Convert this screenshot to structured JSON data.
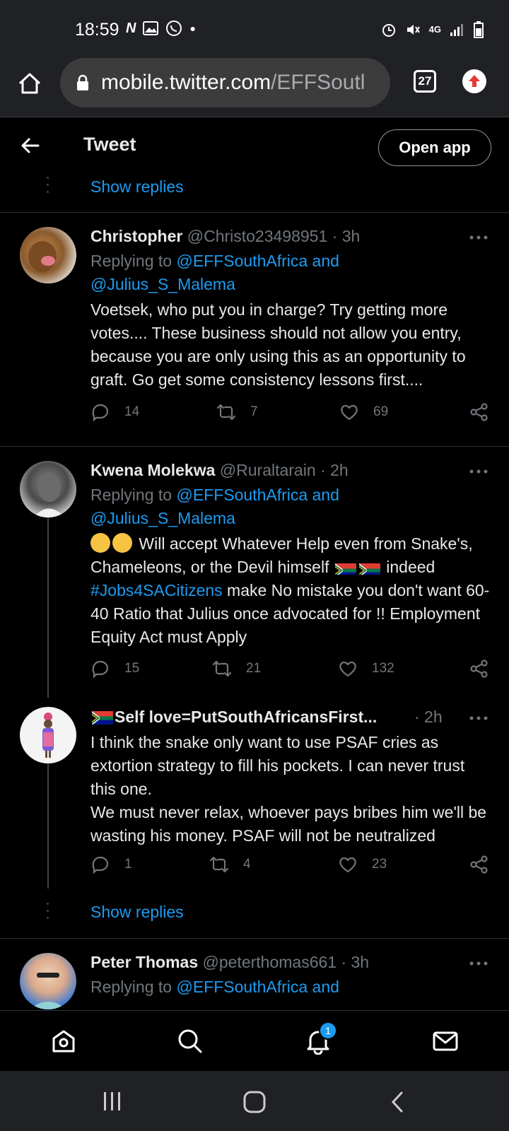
{
  "status_bar": {
    "time": "18:59",
    "network": "4G"
  },
  "browser": {
    "url_host": "mobile.twitter.com",
    "url_path": "/EFFSoutl",
    "tab_count": "27"
  },
  "header": {
    "title": "Tweet",
    "open_app": "Open app"
  },
  "feed": {
    "show_replies_top": "Show replies",
    "show_replies_bottom": "Show replies",
    "tweets": [
      {
        "name": "Christopher",
        "handle": "@Christo23498951",
        "time": "· 3h",
        "replying_prefix": "Replying to ",
        "replying_to": "@EFFSouthAfrica and",
        "replying_to2": "@Julius_S_Malema",
        "text": "Voetsek, who put you in charge? Try getting more votes.... These business should not allow you entry, because you are only using this as an opportunity to graft. Go get some consistency lessons first....",
        "replies": "14",
        "retweets": "7",
        "likes": "69"
      },
      {
        "name": "Kwena Molekwa",
        "handle": "@Ruraltarain",
        "time": "· 2h",
        "replying_prefix": "Replying to ",
        "replying_to": "@EFFSouthAfrica and",
        "replying_to2": "@Julius_S_Malema",
        "text_a": " Will accept Whatever Help even from Snake's,  Chameleons, or the Devil himself ",
        "text_b": "indeed ",
        "hashtag": "#Jobs4SACitizens",
        "text_c": " make No mistake you don't want 60-40 Ratio that Julius once advocated for !! Employment Equity Act must Apply",
        "replies": "15",
        "retweets": "21",
        "likes": "132"
      },
      {
        "name": "Self love=PutSouthAfricansFirst...",
        "time": "· 2h",
        "text1": "I think the snake only want to use PSAF cries as extortion strategy to fill his pockets. I can never trust this one.",
        "text2": "We must never relax, whoever pays bribes him we'll be wasting his money. PSAF will not be neutralized",
        "replies": "1",
        "retweets": "4",
        "likes": "23"
      },
      {
        "name": "Peter Thomas",
        "handle": "@peterthomas661",
        "time": "· 3h",
        "replying_prefix": "Replying to ",
        "replying_to": "@EFFSouthAfrica and"
      }
    ]
  },
  "bottom_nav": {
    "notification_count": "1"
  },
  "icons": [
    "home-icon",
    "search-icon",
    "bell-icon",
    "mail-icon",
    "reply-icon",
    "retweet-icon",
    "like-icon",
    "share-icon",
    "more-icon"
  ],
  "colors": {
    "accent": "#1d9bf0",
    "muted": "#71767b",
    "background": "#000000",
    "chrome": "#202124"
  }
}
